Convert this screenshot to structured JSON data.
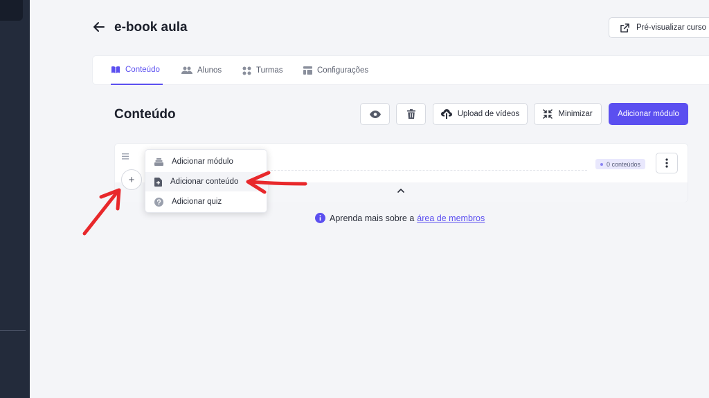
{
  "header": {
    "title": "e-book aula",
    "preview_label": "Pré-visualizar curso"
  },
  "tabs": [
    {
      "label": "Conteúdo",
      "icon": "book-icon",
      "active": true
    },
    {
      "label": "Alunos",
      "icon": "users-icon",
      "active": false
    },
    {
      "label": "Turmas",
      "icon": "grid-icon",
      "active": false
    },
    {
      "label": "Configurações",
      "icon": "layout-icon",
      "active": false
    }
  ],
  "section": {
    "title": "Conteúdo",
    "upload_label": "Upload de vídeos",
    "minimize_label": "Minimizar",
    "add_module_label": "Adicionar módulo"
  },
  "module": {
    "count_badge": "0 conteúdos"
  },
  "dropdown": {
    "items": [
      {
        "label": "Adicionar módulo",
        "icon": "stack-icon"
      },
      {
        "label": "Adicionar conteúdo",
        "icon": "file-plus-icon"
      },
      {
        "label": "Adicionar quiz",
        "icon": "question-circle-icon"
      }
    ]
  },
  "info": {
    "text": "Aprenda mais sobre a",
    "link": "área de membros"
  },
  "colors": {
    "accent": "#5b4ff0",
    "sidebar": "#232b3b",
    "annotation": "#e8282b"
  }
}
